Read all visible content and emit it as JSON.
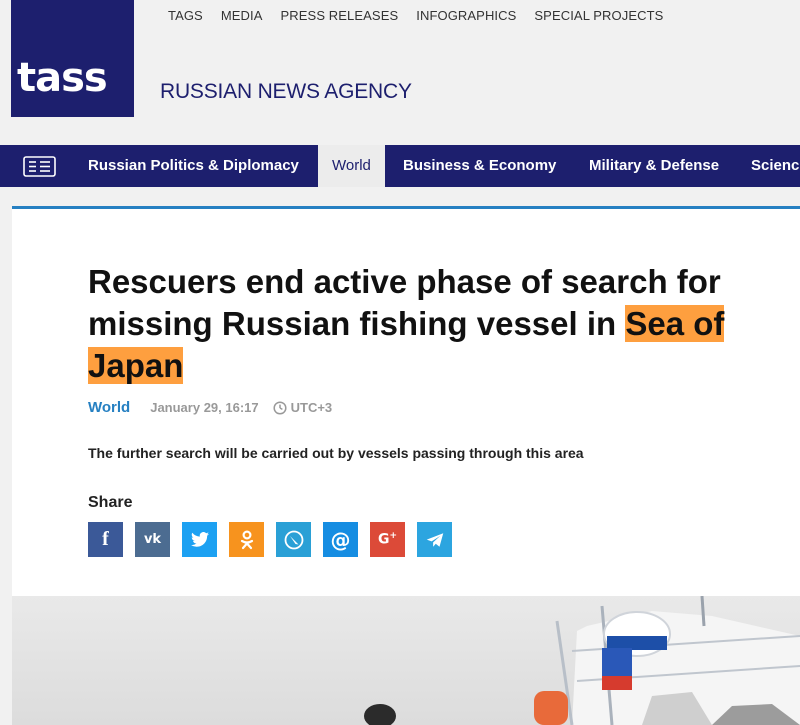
{
  "header": {
    "logo_text": "tass",
    "agency_name": "RUSSIAN NEWS AGENCY",
    "top_menu": [
      "TAGS",
      "MEDIA",
      "PRESS RELEASES",
      "INFOGRAPHICS",
      "SPECIAL PROJECTS"
    ]
  },
  "nav": {
    "items": [
      "Russian Politics & Diplomacy",
      "World",
      "Business & Economy",
      "Military & Defense",
      "Science"
    ],
    "active": "World"
  },
  "article": {
    "headline_part1": "Rescuers end active phase of search for missing Russian fishing vessel in ",
    "headline_highlight_1": "Sea of",
    "headline_highlight_2": "Japan",
    "category": "World",
    "date": "January 29, 16:17",
    "timezone": "UTC+3",
    "lead": "The further search will be carried out by vessels passing through this area",
    "share_label": "Share",
    "share_buttons": [
      {
        "name": "facebook",
        "glyph": "f",
        "color": "#3b5998"
      },
      {
        "name": "vkontakte",
        "glyph": "vk",
        "color": "#4c6c91"
      },
      {
        "name": "twitter",
        "glyph": "twitter-bird",
        "color": "#1da1f2"
      },
      {
        "name": "odnoklassniki",
        "glyph": "ok",
        "color": "#f7931e"
      },
      {
        "name": "livejournal",
        "glyph": "pencil",
        "color": "#2aa0d6"
      },
      {
        "name": "mail",
        "glyph": "@",
        "color": "#168de2"
      },
      {
        "name": "google-plus",
        "glyph": "G+",
        "color": "#dc4a38"
      },
      {
        "name": "telegram",
        "glyph": "paper-plane",
        "color": "#2ca5e0"
      }
    ]
  },
  "colors": {
    "brand_navy": "#1d1f6e",
    "accent_blue": "#2680c2",
    "highlight_orange": "#fe9f3f"
  }
}
